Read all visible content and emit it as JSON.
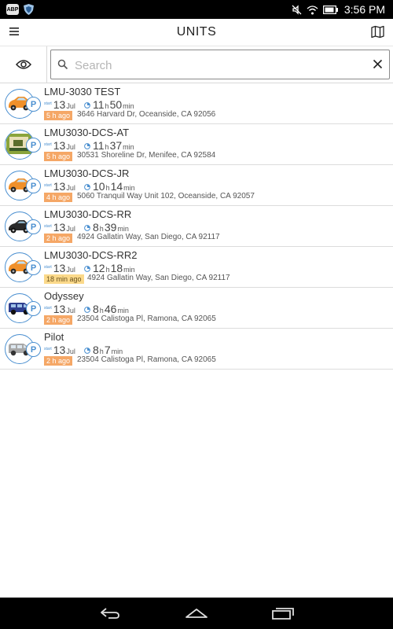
{
  "status_bar": {
    "app_notif_label": "ABP",
    "time": "3:56 PM"
  },
  "app_bar": {
    "title": "UNITS",
    "menu_icon": "hamburger-menu-icon",
    "map_icon": "map-icon"
  },
  "filter": {
    "visibility_icon": "eye-icon"
  },
  "search": {
    "placeholder": "Search",
    "value": ""
  },
  "colors": {
    "accent": "#4a8fd0",
    "badge_orange": "#f5a766",
    "badge_yellow": "#fbd98a"
  },
  "units": [
    {
      "name": "LMU-3030 TEST",
      "start_tag": "start",
      "day": "13",
      "month": "Jul",
      "hours": "11",
      "h": "h",
      "minutes": "50",
      "min": "min",
      "ago": "5 h ago",
      "address": "3646 Harvard Dr, Oceanside, CA 92056",
      "vehicle": "car-orange-icon"
    },
    {
      "name": "LMU3030-DCS-AT",
      "start_tag": "start",
      "day": "13",
      "month": "Jul",
      "hours": "11",
      "h": "h",
      "minutes": "37",
      "min": "min",
      "ago": "5 h ago",
      "address": "30531 Shoreline Dr, Menifee, CA 92584",
      "vehicle": "photo-icon"
    },
    {
      "name": "LMU3030-DCS-JR",
      "start_tag": "start",
      "day": "13",
      "month": "Jul",
      "hours": "10",
      "h": "h",
      "minutes": "14",
      "min": "min",
      "ago": "4 h ago",
      "address": "5060 Tranquil Way Unit 102, Oceanside, CA 92057",
      "vehicle": "car-orange-icon"
    },
    {
      "name": "LMU3030-DCS-RR",
      "start_tag": "start",
      "day": "13",
      "month": "Jul",
      "hours": "8",
      "h": "h",
      "minutes": "39",
      "min": "min",
      "ago": "2 h ago",
      "address": "4924 Gallatin Way, San Diego, CA 92117",
      "vehicle": "car-black-icon"
    },
    {
      "name": "LMU3030-DCS-RR2",
      "start_tag": "start",
      "day": "13",
      "month": "Jul",
      "hours": "12",
      "h": "h",
      "minutes": "18",
      "min": "min",
      "ago": "18 min ago",
      "address": "4924 Gallatin Way, San Diego, CA 92117",
      "vehicle": "car-orange-icon"
    },
    {
      "name": "Odyssey",
      "start_tag": "start",
      "day": "13",
      "month": "Jul",
      "hours": "8",
      "h": "h",
      "minutes": "46",
      "min": "min",
      "ago": "2 h ago",
      "address": "23504 Calistoga Pl, Ramona, CA 92065",
      "vehicle": "van-blue-icon"
    },
    {
      "name": "Pilot",
      "start_tag": "start",
      "day": "13",
      "month": "Jul",
      "hours": "8",
      "h": "h",
      "minutes": "7",
      "min": "min",
      "ago": "2 h ago",
      "address": "23504 Calistoga Pl, Ramona, CA 92065",
      "vehicle": "suv-gray-icon"
    }
  ],
  "nav_bar": {
    "back_icon": "back-icon",
    "home_icon": "home-icon",
    "recents_icon": "recent-apps-icon"
  }
}
